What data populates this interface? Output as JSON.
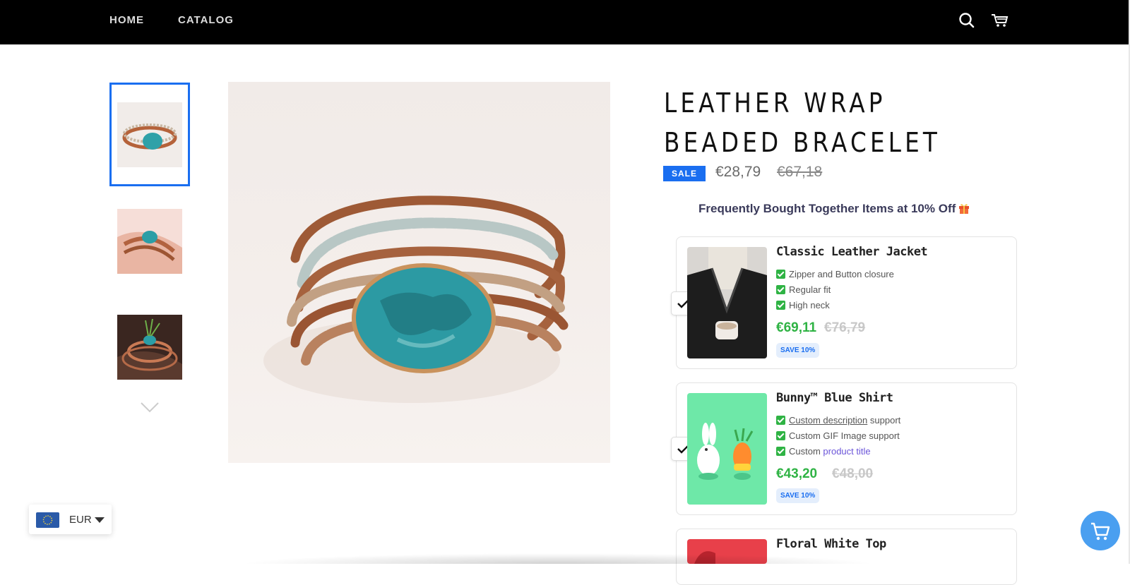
{
  "nav": {
    "home": "HOME",
    "catalog": "CATALOG"
  },
  "header_icons": [
    "search-icon",
    "cart-icon"
  ],
  "product": {
    "title": "LEATHER WRAP BEADED BRACELET",
    "sale_badge": "SALE",
    "price": "€28,79",
    "compare_price": "€67,18"
  },
  "fbt": {
    "heading": "Frequently Bought Together Items at 10% Off",
    "items": [
      {
        "title": "Classic Leather Jacket",
        "features": [
          "Zipper and Button closure",
          "Regular fit",
          "High neck"
        ],
        "price": "€69,11",
        "compare_price": "€76,79",
        "badge": "SAVE 10%",
        "checked": true
      },
      {
        "title": "Bunny™ Blue Shirt",
        "features_rich": [
          {
            "link": "Custom description",
            "rest": " support"
          },
          {
            "text": "Custom GIF Image support"
          },
          {
            "text": "Custom ",
            "accent": "product title"
          }
        ],
        "price": "€43,20",
        "compare_price": "€48,00",
        "badge": "SAVE 10%",
        "checked": true
      },
      {
        "title": "Floral White Top"
      }
    ]
  },
  "currency": {
    "code": "EUR"
  },
  "colors": {
    "accent": "#1a6ef0",
    "green": "#2fb344",
    "topbar": "#000000"
  }
}
